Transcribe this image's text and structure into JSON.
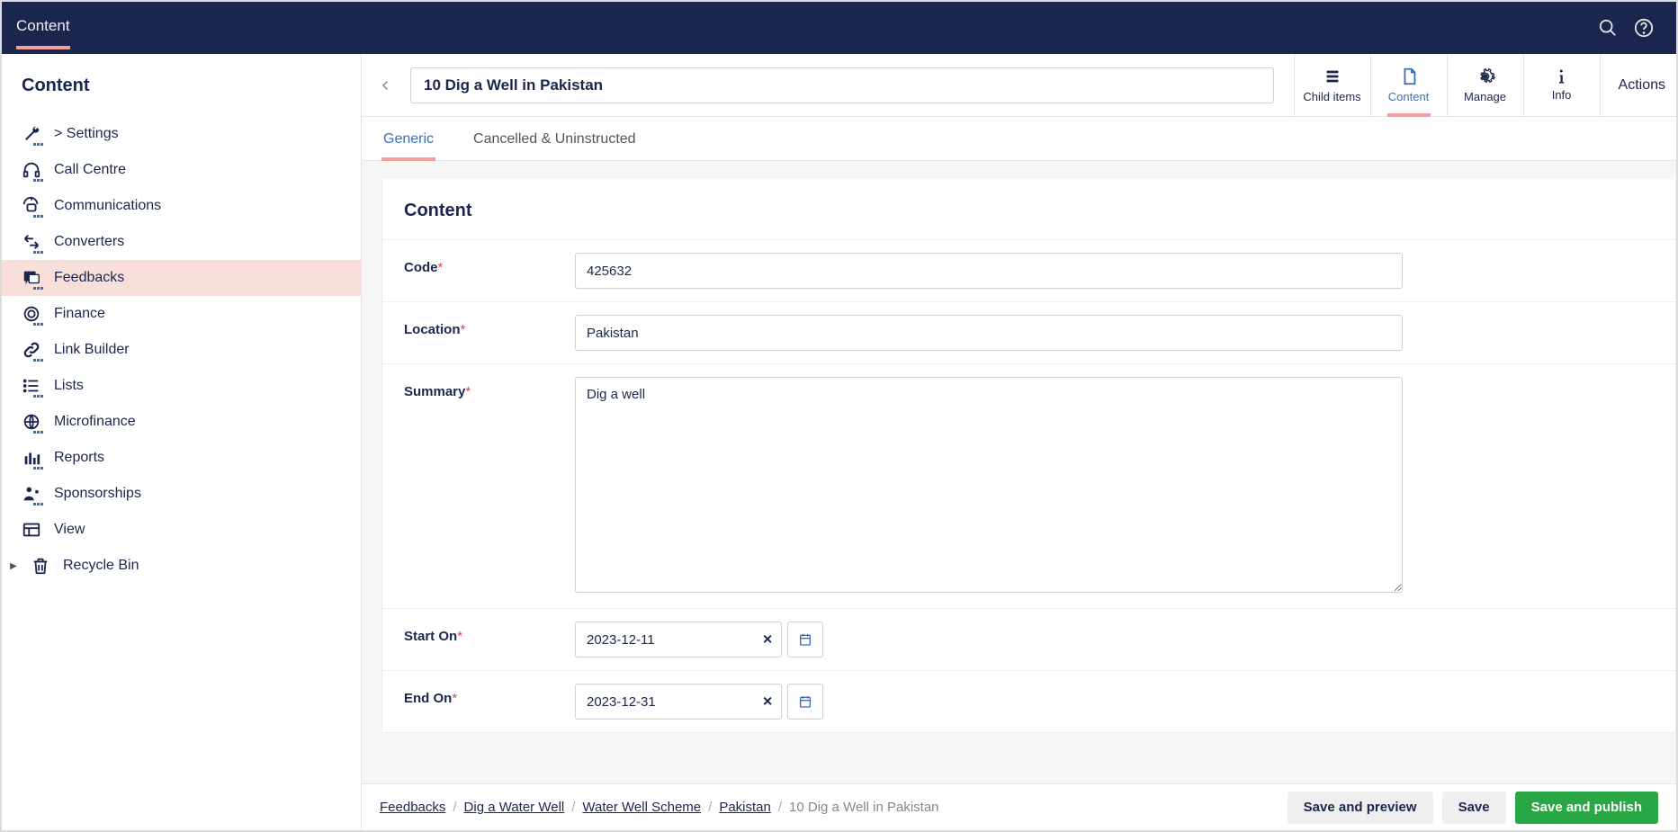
{
  "topbar": {
    "active_tab": "Content"
  },
  "sidebar": {
    "title": "Content",
    "items": [
      {
        "label": "> Settings",
        "icon": "wrench"
      },
      {
        "label": "Call Centre",
        "icon": "headphones"
      },
      {
        "label": "Communications",
        "icon": "comms"
      },
      {
        "label": "Converters",
        "icon": "converters"
      },
      {
        "label": "Feedbacks",
        "icon": "feedback",
        "active": true
      },
      {
        "label": "Finance",
        "icon": "coin"
      },
      {
        "label": "Link Builder",
        "icon": "link"
      },
      {
        "label": "Lists",
        "icon": "list"
      },
      {
        "label": "Microfinance",
        "icon": "globe-coin"
      },
      {
        "label": "Reports",
        "icon": "reports"
      },
      {
        "label": "Sponsorships",
        "icon": "sponsor"
      },
      {
        "label": "View",
        "icon": "view"
      },
      {
        "label": "Recycle Bin",
        "icon": "trash",
        "caret": true
      }
    ]
  },
  "editor": {
    "title_value": "10 Dig a Well in Pakistan",
    "app_tabs": [
      {
        "label": "Child items"
      },
      {
        "label": "Content",
        "active": true
      },
      {
        "label": "Manage"
      },
      {
        "label": "Info"
      }
    ],
    "actions_label": "Actions",
    "sub_tabs": [
      {
        "label": "Generic",
        "active": true
      },
      {
        "label": "Cancelled & Uninstructed"
      }
    ]
  },
  "form": {
    "card_title": "Content",
    "fields": {
      "code": {
        "label": "Code",
        "required": true,
        "value": "425632"
      },
      "location": {
        "label": "Location",
        "required": true,
        "value": "Pakistan"
      },
      "summary": {
        "label": "Summary",
        "required": true,
        "value": "Dig a well"
      },
      "start_on": {
        "label": "Start On",
        "required": true,
        "value": "2023-12-11"
      },
      "end_on": {
        "label": "End On",
        "required": true,
        "value": "2023-12-31"
      }
    }
  },
  "breadcrumb": {
    "items": [
      "Feedbacks",
      "Dig a Water Well",
      "Water Well Scheme",
      "Pakistan"
    ],
    "current": "10 Dig a Well in Pakistan"
  },
  "footer_buttons": {
    "save_preview": "Save and preview",
    "save": "Save",
    "save_publish": "Save and publish"
  }
}
